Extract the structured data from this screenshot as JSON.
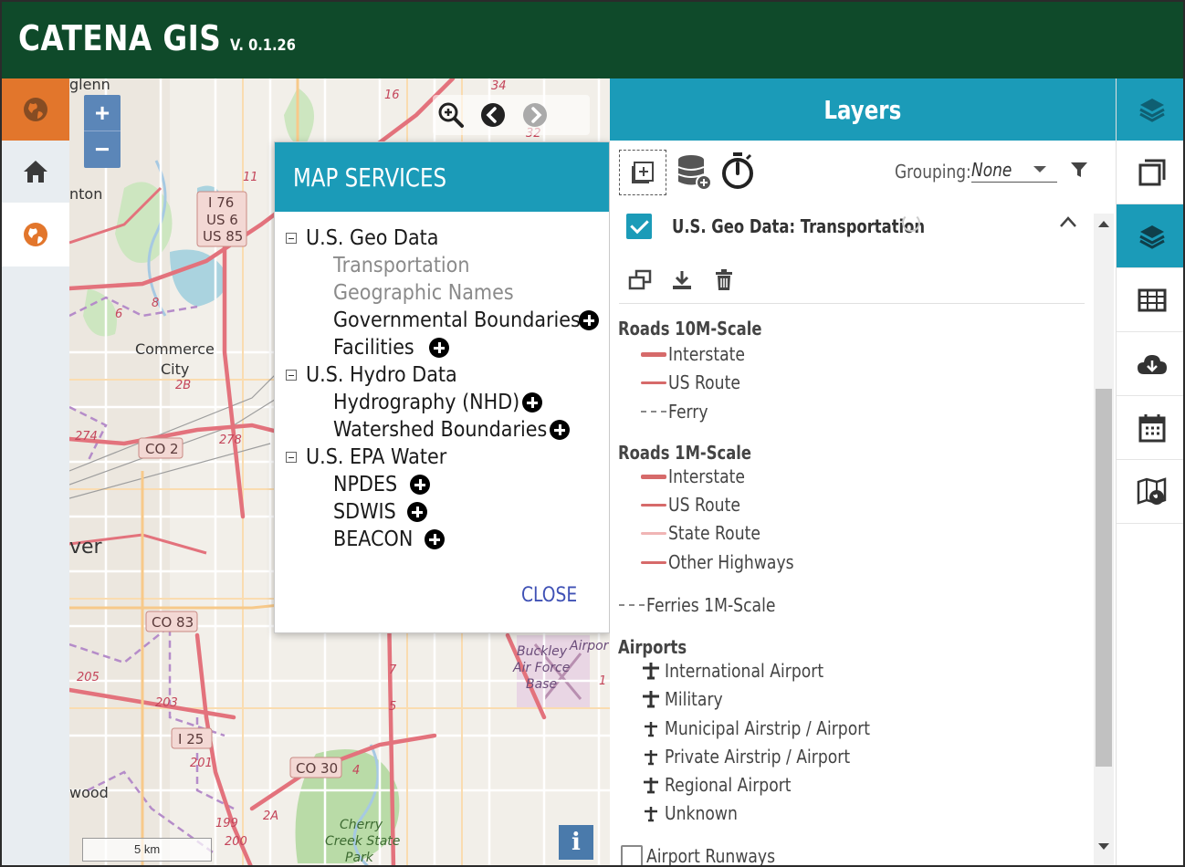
{
  "header": {
    "app_title": "CATENA GIS",
    "version": "V. 0.1.26",
    "background_color": "#0f4a2a"
  },
  "colors": {
    "accent": "#1b9bb8",
    "orange": "#e2762c",
    "road": "#d66a6a",
    "link": "#3f51b5"
  },
  "left_sidebar": {
    "items": [
      {
        "icon": "globe-icon",
        "active": true
      },
      {
        "icon": "home-icon"
      },
      {
        "icon": "globe-icon",
        "selected": true
      }
    ]
  },
  "map": {
    "zoom_in_label": "+",
    "zoom_out_label": "−",
    "scale_label": "5 km",
    "info_label": "i",
    "labels": [
      {
        "text": "glenn"
      },
      {
        "text": "nton"
      },
      {
        "text": "Commerce"
      },
      {
        "text": "City"
      },
      {
        "text": "ver"
      },
      {
        "text": "wood"
      },
      {
        "text": "Buckley"
      },
      {
        "text": "Air Force"
      },
      {
        "text": "Base"
      },
      {
        "text": "Cherry"
      },
      {
        "text": "Creek State"
      },
      {
        "text": "Park"
      },
      {
        "text": "Airpor"
      }
    ],
    "shields": [
      {
        "text": "I 76"
      },
      {
        "text": "US 6"
      },
      {
        "text": "US 85"
      },
      {
        "text": "CO 2"
      },
      {
        "text": "CO 83"
      },
      {
        "text": "I 25"
      },
      {
        "text": "CO 30"
      }
    ],
    "route_numbers": [
      {
        "text": "16"
      },
      {
        "text": "34"
      },
      {
        "text": "32"
      },
      {
        "text": "11"
      },
      {
        "text": "8"
      },
      {
        "text": "6"
      },
      {
        "text": "2B"
      },
      {
        "text": "278"
      },
      {
        "text": "274"
      },
      {
        "text": "205"
      },
      {
        "text": "203"
      },
      {
        "text": "201"
      },
      {
        "text": "199"
      },
      {
        "text": "200"
      },
      {
        "text": "2A"
      },
      {
        "text": "4"
      },
      {
        "text": "5"
      },
      {
        "text": "7"
      },
      {
        "text": "1"
      }
    ]
  },
  "map_services": {
    "title": "MAP SERVICES",
    "close_label": "CLOSE",
    "groups": [
      {
        "label": "U.S. Geo Data",
        "children": [
          {
            "label": "Transportation",
            "disabled": true
          },
          {
            "label": "Geographic Names",
            "disabled": true
          },
          {
            "label": "Governmental Boundaries",
            "add": true
          },
          {
            "label": "Facilities",
            "add": true
          }
        ]
      },
      {
        "label": "U.S. Hydro Data",
        "children": [
          {
            "label": "Hydrography (NHD)",
            "add": true
          },
          {
            "label": "Watershed Boundaries",
            "add": true
          }
        ]
      },
      {
        "label": "U.S. EPA Water",
        "children": [
          {
            "label": "NPDES",
            "add": true
          },
          {
            "label": "SDWIS",
            "add": true
          },
          {
            "label": "BEACON",
            "add": true
          }
        ]
      }
    ]
  },
  "layers_panel": {
    "title": "Layers",
    "grouping_label": "Grouping:",
    "grouping_value": "None",
    "layer": {
      "name": "U.S. Geo Data: Transportation",
      "checked": true
    },
    "legend": {
      "roads_10m": {
        "heading": "Roads 10M-Scale",
        "items": [
          {
            "label": "Interstate",
            "color": "#d66a6a"
          },
          {
            "label": "US Route",
            "color": "#d66a6a"
          },
          {
            "label": "Ferry",
            "color": "#888888"
          }
        ]
      },
      "roads_1m": {
        "heading": "Roads 1M-Scale",
        "items": [
          {
            "label": "Interstate",
            "color": "#d66a6a"
          },
          {
            "label": "US Route",
            "color": "#d66a6a"
          },
          {
            "label": "State Route",
            "color": "#f0b5b5"
          },
          {
            "label": "Other Highways",
            "color": "#d66a6a"
          }
        ]
      },
      "ferries_1m": {
        "label": "Ferries 1M-Scale"
      },
      "airports": {
        "heading": "Airports",
        "items": [
          {
            "label": "International Airport"
          },
          {
            "label": "Military"
          },
          {
            "label": "Municipal Airstrip / Airport"
          },
          {
            "label": "Private Airstrip / Airport"
          },
          {
            "label": "Regional Airport"
          },
          {
            "label": "Unknown"
          }
        ]
      },
      "airport_runways": {
        "label": "Airport Runways"
      }
    }
  },
  "right_rail": {
    "items": [
      {
        "icon": "layers-icon"
      },
      {
        "icon": "window-icon"
      },
      {
        "icon": "layers-icon",
        "active": true
      },
      {
        "icon": "table-icon"
      },
      {
        "icon": "cloud-download-icon"
      },
      {
        "icon": "calendar-icon"
      },
      {
        "icon": "map-globe-icon"
      }
    ]
  }
}
